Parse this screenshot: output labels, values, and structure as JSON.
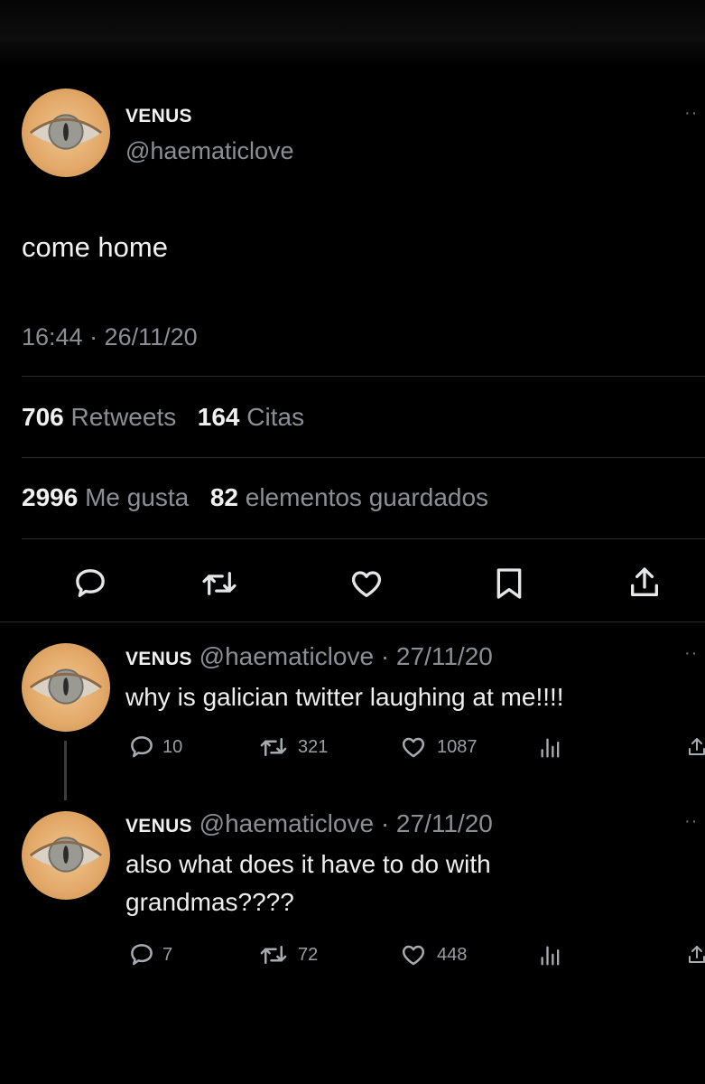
{
  "main_tweet": {
    "display_name": "VENUS",
    "handle": "@haematiclove",
    "text": "come home",
    "timestamp": "16:44 · 26/11/20",
    "retweets_count": "706",
    "retweets_label": "Retweets",
    "quotes_count": "164",
    "quotes_label": "Citas",
    "likes_count": "2996",
    "likes_label": "Me gusta",
    "bookmarks_count": "82",
    "bookmarks_label": "elementos guardados"
  },
  "replies": [
    {
      "display_name": "VENUS",
      "handle": "@haematiclove",
      "date": "· 27/11/20",
      "text": "why is galician twitter laughing at me!!!!",
      "reply_count": "10",
      "retweet_count": "321",
      "like_count": "1087"
    },
    {
      "display_name": "VENUS",
      "handle": "@haematiclove",
      "date": "· 27/11/20",
      "text_line1": "also what does it have to do with",
      "text_line2": "grandmas????",
      "reply_count": "7",
      "retweet_count": "72",
      "like_count": "448"
    }
  ],
  "icons": {
    "reply": "reply-icon",
    "retweet": "retweet-icon",
    "like": "heart-icon",
    "bookmark": "bookmark-icon",
    "share": "share-icon",
    "analytics": "analytics-icon",
    "more": "more-icon"
  },
  "colors": {
    "background": "#000000",
    "text": "#e7e9ea",
    "muted": "#8b8f94",
    "avatar": "#e2a868"
  }
}
